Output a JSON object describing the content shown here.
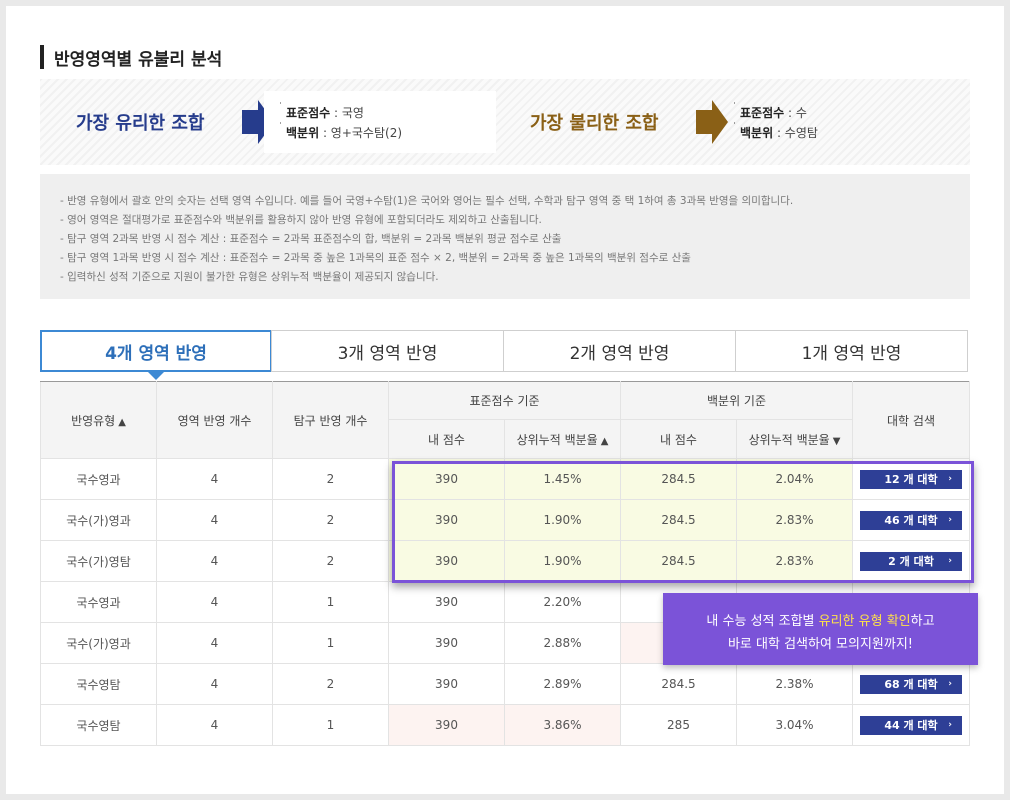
{
  "section": {
    "title": "반영영역별 유불리 분석"
  },
  "best": {
    "label": "가장 유리한 조합",
    "line1_key": "표준점수",
    "line1_value": " : 국영",
    "line2_key": "백분위",
    "line2_value": " : 영+국수탐(2)"
  },
  "worst": {
    "label": "가장 불리한 조합",
    "line1_key": "표준점수",
    "line1_value": " : 수",
    "line2_key": "백분위",
    "line2_value": " : 수영탐"
  },
  "notes": [
    "- 반영 유형에서 괄호 안의 숫자는 선택 영역 수입니다. 예를 들어 국영+수탐(1)은 국어와 영어는 필수 선택, 수학과 탐구 영역 중 택 1하여 총 3과목 반영을 의미합니다.",
    "- 영어 영역은 절대평가로 표준점수와 백분위를 활용하지 않아 반영 유형에 포함되더라도 제외하고 산출됩니다.",
    "- 탐구 영역 2과목 반영 시 점수 계산 : 표준점수 = 2과목 표준점수의 합, 백분위 = 2과목 백분위 평균 점수로 산출",
    "- 탐구 영역 1과목 반영 시 점수 계산 : 표준점수 = 2과목 중 높은 1과목의 표준 점수 × 2, 백분위 = 2과목 중 높은 1과목의 백분위 점수로 산출",
    "- 입력하신 성적 기준으로 지원이 불가한 유형은 상위누적 백분율이 제공되지 않습니다."
  ],
  "tabs": [
    "4개 영역 반영",
    "3개 영역 반영",
    "2개 영역 반영",
    "1개 영역 반영"
  ],
  "table": {
    "headers": {
      "type": "반영유형",
      "type_sort": "▲",
      "area_count": "영역 반영 개수",
      "inquiry_count": "탐구 반영 개수",
      "std_group": "표준점수 기준",
      "pct_group": "백분위 기준",
      "my_score": "내 점수",
      "cum_pct": "상위누적 백분율",
      "std_sort": "▲",
      "pct_sort": "▼",
      "search": "대학 검색"
    },
    "rows": [
      {
        "type": "국수영과",
        "areas": "4",
        "inquiry": "2",
        "std_score": "390",
        "std_pct": "1.45%",
        "pct_score": "284.5",
        "pct_pct": "2.04%",
        "btn": "12 개 대학",
        "btn_chev": "›"
      },
      {
        "type": "국수(가)영과",
        "areas": "4",
        "inquiry": "2",
        "std_score": "390",
        "std_pct": "1.90%",
        "pct_score": "284.5",
        "pct_pct": "2.83%",
        "btn": "46 개 대학",
        "btn_chev": "›"
      },
      {
        "type": "국수(가)영탐",
        "areas": "4",
        "inquiry": "2",
        "std_score": "390",
        "std_pct": "1.90%",
        "pct_score": "284.5",
        "pct_pct": "2.83%",
        "btn": "2 개 대학",
        "btn_chev": "›"
      },
      {
        "type": "국수영과",
        "areas": "4",
        "inquiry": "1",
        "std_score": "390",
        "std_pct": "2.20%",
        "pct_score": "",
        "pct_pct": "",
        "btn": "",
        "btn_chev": ""
      },
      {
        "type": "국수(가)영과",
        "areas": "4",
        "inquiry": "1",
        "std_score": "390",
        "std_pct": "2.88%",
        "pct_score": "",
        "pct_pct": "",
        "btn": "",
        "btn_chev": ""
      },
      {
        "type": "국수영탐",
        "areas": "4",
        "inquiry": "2",
        "std_score": "390",
        "std_pct": "2.89%",
        "pct_score": "284.5",
        "pct_pct": "2.38%",
        "btn": "68 개 대학",
        "btn_chev": "›"
      },
      {
        "type": "국수영탐",
        "areas": "4",
        "inquiry": "1",
        "std_score": "390",
        "std_pct": "3.86%",
        "pct_score": "285",
        "pct_pct": "3.04%",
        "btn": "44 개 대학",
        "btn_chev": "›"
      }
    ]
  },
  "callout": {
    "line1_pre": "내 수능 성적 조합별 ",
    "line1_em": "유리한 유형 확인",
    "line1_post": "하고",
    "line2": "바로 대학 검색하여 모의지원까지!"
  },
  "colors": {
    "accent_blue": "#3c89d4",
    "best_blue": "#263c8c",
    "worst_brown": "#8a6016",
    "highlight_purple": "#7b53d8",
    "button_navy": "#2e3f96"
  }
}
